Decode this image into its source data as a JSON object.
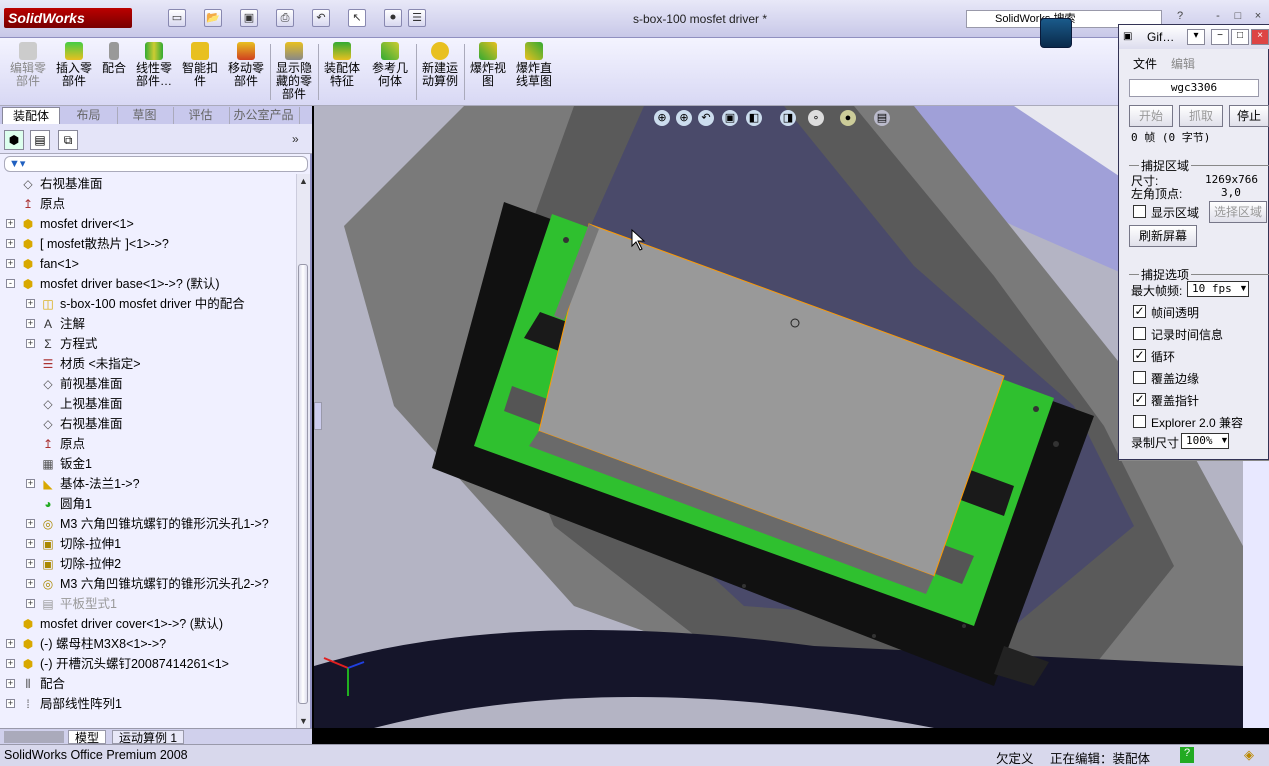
{
  "window": {
    "title": "s-box-100 mosfet driver *",
    "app_logo": "SolidWorks",
    "search_placeholder": "SolidWorks 搜索",
    "controls": [
      "?",
      "-",
      "□",
      "×"
    ]
  },
  "command_manager": {
    "buttons": [
      {
        "label": "编辑零\n部件",
        "icon": "edit-component-icon",
        "disabled": true
      },
      {
        "label": "插入零\n部件",
        "icon": "insert-component-icon"
      },
      {
        "label": "配合",
        "icon": "mate-icon"
      },
      {
        "label": "线性零\n部件…",
        "icon": "linear-pattern-icon"
      },
      {
        "label": "智能扣\n件",
        "icon": "smart-fastener-icon"
      },
      {
        "label": "移动零\n部件",
        "icon": "move-component-icon"
      },
      {
        "label": "显示隐\n藏的零\n部件",
        "icon": "show-hidden-icon"
      },
      {
        "label": "装配体\n特征",
        "icon": "assembly-feature-icon"
      },
      {
        "label": "参考几\n何体",
        "icon": "reference-geometry-icon"
      },
      {
        "label": "新建运\n动算例",
        "icon": "new-motion-study-icon"
      },
      {
        "label": "爆炸视\n图",
        "icon": "exploded-view-icon"
      },
      {
        "label": "爆炸直\n线草图",
        "icon": "explode-line-sketch-icon"
      }
    ],
    "tabs": [
      "装配体",
      "布局",
      "草图",
      "评估",
      "办公室产品"
    ]
  },
  "feature_tree": {
    "items": [
      {
        "label": "右视基准面",
        "icon": "plane-icon",
        "level": 0
      },
      {
        "label": "原点",
        "icon": "origin-icon",
        "level": 0
      },
      {
        "label": "mosfet driver<1>",
        "icon": "part-icon",
        "level": 0,
        "expand": "+"
      },
      {
        "label": "[ mosfet散热片 ]<1>->?",
        "icon": "part-icon",
        "level": 0,
        "expand": "+"
      },
      {
        "label": "fan<1>",
        "icon": "part-icon",
        "level": 0,
        "expand": "+"
      },
      {
        "label": "mosfet driver base<1>->? (默认)",
        "icon": "part-icon",
        "level": 0,
        "expand": "-"
      },
      {
        "label": "s-box-100 mosfet driver 中的配合",
        "icon": "mates-folder-icon",
        "level": 1,
        "expand": "+"
      },
      {
        "label": "注解",
        "icon": "annotations-icon",
        "level": 1,
        "expand": "+"
      },
      {
        "label": "方程式",
        "icon": "equations-icon",
        "level": 1,
        "expand": "+"
      },
      {
        "label": "材质 <未指定>",
        "icon": "material-icon",
        "level": 1
      },
      {
        "label": "前视基准面",
        "icon": "plane-icon",
        "level": 1
      },
      {
        "label": "上视基准面",
        "icon": "plane-icon",
        "level": 1
      },
      {
        "label": "右视基准面",
        "icon": "plane-icon",
        "level": 1
      },
      {
        "label": "原点",
        "icon": "origin-icon",
        "level": 1
      },
      {
        "label": "钣金1",
        "icon": "sheet-metal-icon",
        "level": 1
      },
      {
        "label": "基体-法兰1->?",
        "icon": "base-flange-icon",
        "level": 1,
        "expand": "+"
      },
      {
        "label": "圆角1",
        "icon": "fillet-icon",
        "level": 1
      },
      {
        "label": "M3 六角凹锥坑螺钉的锥形沉头孔1->?",
        "icon": "hole-wizard-icon",
        "level": 1,
        "expand": "+"
      },
      {
        "label": "切除-拉伸1",
        "icon": "cut-extrude-icon",
        "level": 1,
        "expand": "+"
      },
      {
        "label": "切除-拉伸2",
        "icon": "cut-extrude-icon",
        "level": 1,
        "expand": "+"
      },
      {
        "label": "M3 六角凹锥坑螺钉的锥形沉头孔2->?",
        "icon": "hole-wizard-icon",
        "level": 1,
        "expand": "+"
      },
      {
        "label": "平板型式1",
        "icon": "flat-pattern-icon",
        "level": 1,
        "expand": "+",
        "dim": true
      },
      {
        "label": "mosfet driver cover<1>->? (默认)",
        "icon": "part-icon",
        "level": 0
      },
      {
        "label": "(-) 螺母柱M3X8<1>->?",
        "icon": "part-icon",
        "level": 0,
        "expand": "+"
      },
      {
        "label": "(-) 开槽沉头螺钉20087414261<1>",
        "icon": "part-icon",
        "level": 0,
        "expand": "+"
      },
      {
        "label": "配合",
        "icon": "mates-icon",
        "level": 0,
        "expand": "+"
      },
      {
        "label": "局部线性阵列1",
        "icon": "local-pattern-icon",
        "level": 0,
        "expand": "+"
      }
    ]
  },
  "bottom_tabs": [
    "模型",
    "运动算例 1"
  ],
  "gif_recorder": {
    "title": "Gif…",
    "menu": [
      "文件",
      "编辑"
    ],
    "filename": "wgc3306",
    "buttons": {
      "start": "开始",
      "grab": "抓取",
      "stop": "停止"
    },
    "frame_info": "0 帧 (0 字节)",
    "capture_area": {
      "heading": "捕捉区域",
      "size_label": "尺寸:",
      "size_value": "1269x766",
      "corner_label": "左角顶点:",
      "corner_value": "3,0",
      "show_area": "显示区域",
      "select_area": "选择区域",
      "refresh": "刷新屏幕"
    },
    "capture_options": {
      "heading": "捕捉选项",
      "max_fps_label": "最大帧频:",
      "max_fps_value": "10 fps",
      "options": [
        {
          "label": "帧间透明",
          "checked": true
        },
        {
          "label": "记录时间信息",
          "checked": false
        },
        {
          "label": "循环",
          "checked": true
        },
        {
          "label": "覆盖边缘",
          "checked": false
        },
        {
          "label": "覆盖指针",
          "checked": true
        },
        {
          "label": "Explorer 2.0 兼容",
          "checked": false
        }
      ],
      "record_size_label": "录制尺寸",
      "record_size_value": "100%"
    }
  },
  "status_bar": {
    "product": "SolidWorks Office Premium 2008",
    "state": "欠定义",
    "editing": "正在编辑：装配体"
  },
  "colors": {
    "panel_bg": "#f0f0ff",
    "part_green": "#2fc02f",
    "selection_orange": "#ff9a00"
  }
}
